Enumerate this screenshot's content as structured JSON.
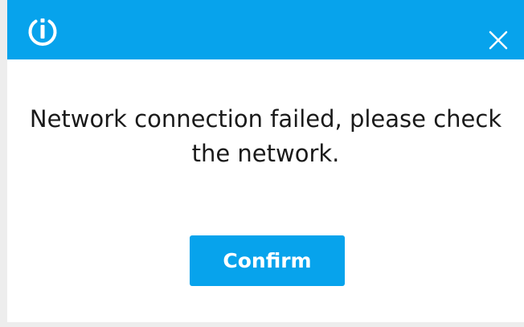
{
  "dialog": {
    "message_line1": "Network connection failed, please check",
    "message_line2": "the network.",
    "confirm_label": "Confirm",
    "icons": {
      "logo": "power-info-logo-icon",
      "close": "close-icon"
    },
    "colors": {
      "accent": "#07a3ec",
      "text": "#1a1a1a",
      "button_text": "#ffffff"
    }
  }
}
